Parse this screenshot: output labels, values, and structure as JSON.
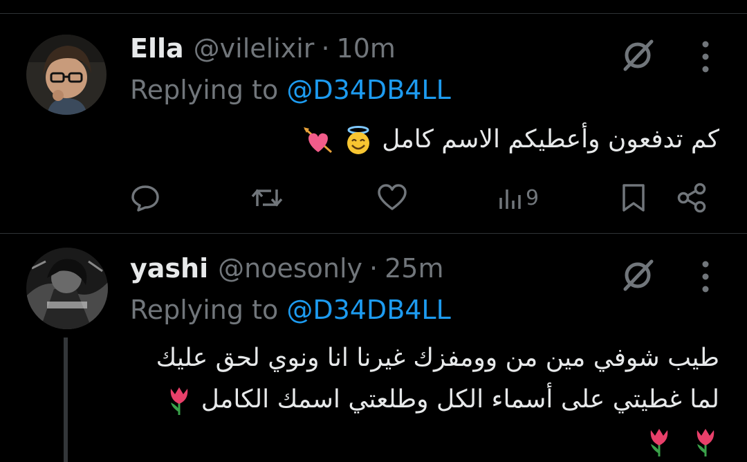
{
  "tweets": [
    {
      "name": "Ella",
      "handle": "@vilelixir",
      "dot": "·",
      "time": "10m",
      "replying_prefix": "Replying to ",
      "replying_to": "@D34DB4LL",
      "text_lines": [
        "كم تدفعون وأعطيكم الاسم كامل"
      ],
      "emojis": [
        "smiling-face-with-halo",
        "heart-with-arrow"
      ],
      "views": "9"
    },
    {
      "name": "yashi",
      "handle": "@noesonly",
      "dot": "·",
      "time": "25m",
      "replying_prefix": "Replying to ",
      "replying_to": "@D34DB4LL",
      "text_lines": [
        "طيب شوفي مين من وومفزك غيرنا انا ونوي لحق عليك",
        "لما غطيتي على أسماء الكل وطلعتي اسمك الكامل"
      ],
      "emojis": [
        "tulip",
        "tulip",
        "tulip"
      ]
    }
  ],
  "colors": {
    "background": "#000000",
    "text": "#e7e9ea",
    "muted": "#71767b",
    "mention": "#1d9bf0",
    "divider": "#2f3336"
  },
  "icons": [
    "reply-icon",
    "retweet-icon",
    "like-icon",
    "views-icon",
    "bookmark-icon",
    "share-icon",
    "grok-icon",
    "more-icon"
  ]
}
